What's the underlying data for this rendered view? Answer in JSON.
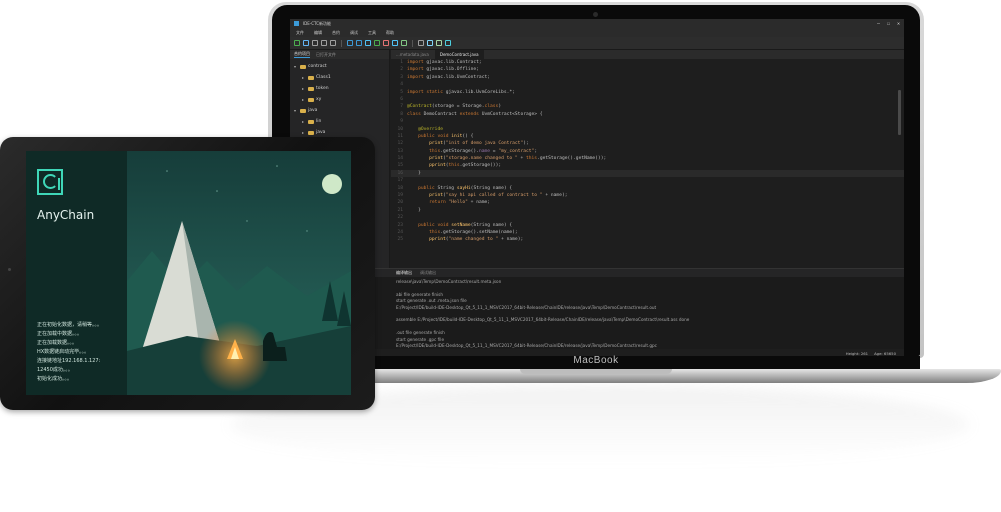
{
  "laptop": {
    "brand": "MacBook",
    "window_title": "IDE-CTC新功能",
    "window_controls": [
      "—",
      "☐",
      "✕"
    ],
    "menus": [
      "文件",
      "编辑",
      "合约",
      "调试",
      "工具",
      "帮助"
    ],
    "toolbar_icons": [
      "new-file-icon",
      "open-icon",
      "save-icon",
      "save-all-icon",
      "cut-icon",
      "build-icon",
      "compile-icon",
      "run-icon",
      "debug-icon",
      "stop-icon",
      "step-icon",
      "deploy-icon",
      "settings-icon",
      "list-icon",
      "package-icon",
      "help-icon"
    ],
    "sidebar": {
      "tabs": [
        "合约项目",
        "已打开文件"
      ],
      "tree": [
        {
          "label": "contract",
          "indent": 0,
          "type": "folder",
          "arrow": "▾"
        },
        {
          "label": "Class1",
          "indent": 1,
          "type": "folder",
          "arrow": "▸"
        },
        {
          "label": "token",
          "indent": 1,
          "type": "folder",
          "arrow": "▸"
        },
        {
          "label": "xy",
          "indent": 1,
          "type": "folder",
          "arrow": "▸"
        },
        {
          "label": "java",
          "indent": 0,
          "type": "folder",
          "arrow": "▾"
        },
        {
          "label": "lin",
          "indent": 1,
          "type": "folder",
          "arrow": "▸"
        },
        {
          "label": "java",
          "indent": 1,
          "type": "folder",
          "arrow": "▸"
        }
      ]
    },
    "editor_tabs": [
      {
        "label": "...metadata.java",
        "active": false
      },
      {
        "label": "DemoContract.java",
        "active": true
      }
    ],
    "code": [
      [
        [
          "kw",
          "import "
        ],
        [
          "txt",
          "gjavac.lib.Contract;"
        ]
      ],
      [
        [
          "kw",
          "import "
        ],
        [
          "txt",
          "gjavac.lib.Offline;"
        ]
      ],
      [
        [
          "kw",
          "import "
        ],
        [
          "txt",
          "gjavac.lib.UvmContract;"
        ]
      ],
      [],
      [
        [
          "kw",
          "import static "
        ],
        [
          "txt",
          "gjavac.lib.UvmCoreLibs.*;"
        ]
      ],
      [],
      [
        [
          "an",
          "@Contract"
        ],
        [
          "txt",
          "(storage = Storage."
        ],
        [
          "kw",
          "class"
        ],
        [
          "txt",
          ")"
        ]
      ],
      [
        [
          "kw",
          "class "
        ],
        [
          "txt",
          "DemoContract "
        ],
        [
          "kw",
          "extends "
        ],
        [
          "txt",
          "UvmContract<Storage> {"
        ]
      ],
      [],
      [
        [
          "txt",
          "    "
        ],
        [
          "an",
          "@Override"
        ]
      ],
      [
        [
          "txt",
          "    "
        ],
        [
          "kw",
          "public void "
        ],
        [
          "fn",
          "init"
        ],
        [
          "txt",
          "() {"
        ]
      ],
      [
        [
          "txt",
          "        "
        ],
        [
          "fn",
          "print"
        ],
        [
          "txt",
          "("
        ],
        [
          "str",
          "\"init of demo java Contract\""
        ],
        [
          "txt",
          ");"
        ]
      ],
      [
        [
          "txt",
          "        "
        ],
        [
          "kw",
          "this"
        ],
        [
          "txt",
          ".getStorage()."
        ],
        [
          "fld",
          "name"
        ],
        [
          "txt",
          " = "
        ],
        [
          "str",
          "\"my_contract\""
        ],
        [
          "txt",
          ";"
        ]
      ],
      [
        [
          "txt",
          "        "
        ],
        [
          "fn",
          "print"
        ],
        [
          "txt",
          "("
        ],
        [
          "str",
          "\"storage.name changed to \""
        ],
        [
          "txt",
          " + "
        ],
        [
          "kw",
          "this"
        ],
        [
          "txt",
          ".getStorage().getName());"
        ]
      ],
      [
        [
          "txt",
          "        "
        ],
        [
          "fn",
          "pprint"
        ],
        [
          "txt",
          "("
        ],
        [
          "kw",
          "this"
        ],
        [
          "txt",
          ".getStorage());"
        ]
      ],
      [
        [
          "txt",
          "    }"
        ]
      ],
      [],
      [
        [
          "txt",
          "    "
        ],
        [
          "kw",
          "public "
        ],
        [
          "txt",
          "String "
        ],
        [
          "fn",
          "sayHi"
        ],
        [
          "txt",
          "(String name) {"
        ]
      ],
      [
        [
          "txt",
          "        "
        ],
        [
          "fn",
          "print"
        ],
        [
          "txt",
          "("
        ],
        [
          "str",
          "\"say hi api called of contract to \""
        ],
        [
          "txt",
          " + name);"
        ]
      ],
      [
        [
          "txt",
          "        "
        ],
        [
          "kw",
          "return "
        ],
        [
          "str",
          "\"Hello\""
        ],
        [
          "txt",
          " + name;"
        ]
      ],
      [
        [
          "txt",
          "    }"
        ]
      ],
      [],
      [
        [
          "txt",
          "    "
        ],
        [
          "kw",
          "public void "
        ],
        [
          "fn",
          "setName"
        ],
        [
          "txt",
          "(String name) {"
        ]
      ],
      [
        [
          "txt",
          "        "
        ],
        [
          "kw",
          "this"
        ],
        [
          "txt",
          ".getStorage().setName(name);"
        ]
      ],
      [
        [
          "txt",
          "        "
        ],
        [
          "fn",
          "pprint"
        ],
        [
          "txt",
          "("
        ],
        [
          "str",
          "\"name changed to \""
        ],
        [
          "txt",
          " + name);"
        ]
      ]
    ],
    "console_tabs": [
      "编译输出",
      "调试输出"
    ],
    "console_lines": [
      "release\\java\\Temp\\DemoContract\\result.meta.json",
      "",
      "abi file generate finish",
      "start generate .out .meta.json file",
      "E:/Project/IDE/build-IDE-Desktop_Qt_5_11_1_MSVC2017_64bit-Release/ChainIDE/release/java\\Temp\\DemoContract\\result.out",
      "",
      "assemble E:/Project/IDE/build-IDE-Desktop_Qt_5_11_1_MSVC2017_64bit-Release/ChainIDE/release/java\\Temp\\DemoContract\\result.ass done",
      "",
      ".out file generate finish",
      "start generate .gpc file",
      "E:/Project/IDE/build-IDE-Desktop_Qt_5_11_1_MSVC2017_64bit-Release/ChainIDE/release/java\\Temp\\DemoContract\\result.gpc",
      "",
      "compile finish,see E:/Project/IDE/build-IDE-Desktop_Qt_5_11_1_MSVC2017_64bit-Release/ChainIDE/release/contracts/java/java.gpc"
    ],
    "status": {
      "height": "Height: 261",
      "age": "Age: 65650"
    }
  },
  "tablet": {
    "brand": "AnyChain",
    "log": [
      "正在初始化数据，请稍等。。。",
      "正在加载中数据。。。",
      "正在加载数据。。。",
      "HX数据链启动完毕。。。",
      "连接链地址192.168.1.127:",
      "12450成功。。。",
      "初始化成功。。。"
    ],
    "colors": {
      "accent": "#3fd7b8",
      "panel": "#0f2a26",
      "sky": "#1e4d4a"
    }
  }
}
